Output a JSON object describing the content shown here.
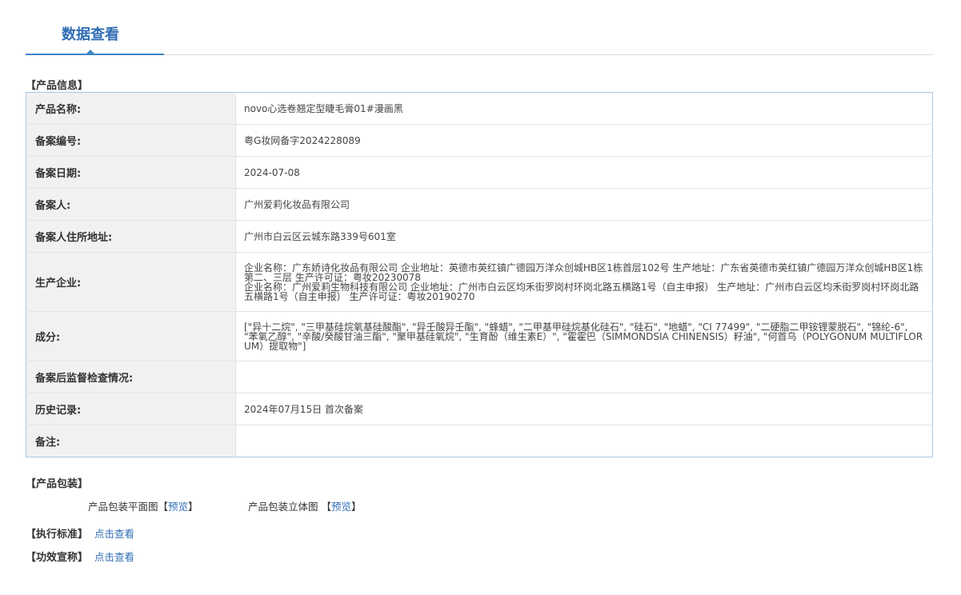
{
  "header": {
    "title": "数据查看"
  },
  "product_info": {
    "heading": "【产品信息】",
    "rows": [
      {
        "label": "产品名称:",
        "value": "novo心选卷翘定型睫毛膏01#漫画黑"
      },
      {
        "label": "备案编号:",
        "value": "粤G妆网备字2024228089"
      },
      {
        "label": "备案日期:",
        "value": "2024-07-08"
      },
      {
        "label": "备案人:",
        "value": "广州爱莉化妆品有限公司"
      },
      {
        "label": "备案人住所地址:",
        "value": "广州市白云区云城东路339号601室"
      },
      {
        "label": "生产企业:",
        "value": "企业名称：广东娇诗化妆品有限公司 企业地址：英德市英红镇广德园万洋众创城HB区1栋首层102号 生产地址：广东省英德市英红镇广德园万洋众创城HB区1栋第二、三层 生产许可证：粤妆20230078\n企业名称：广州爱莉生物科技有限公司 企业地址：广州市白云区均禾街罗岗村环岗北路五横路1号（自主申报） 生产地址：广州市白云区均禾街罗岗村环岗北路五横路1号（自主申报） 生产许可证：粤妆20190270"
      },
      {
        "label": "成分:",
        "value": "[\"异十二烷\", \"三甲基硅烷氧基硅酸酯\", \"异壬酸异壬酯\", \"蜂蜡\", \"二甲基甲硅烷基化硅石\", \"硅石\", \"地蜡\", \"CI 77499\", \"二硬脂二甲铵锂蒙脱石\", \"锦纶-6\", \"苯氧乙醇\", \"辛酸/癸酸甘油三酯\", \"聚甲基硅氧烷\", \"生育酚（维生素E）\", \"霍霍巴（SIMMONDSIA CHINENSIS）籽油\", \"何首乌（POLYGONUM MULTIFLORUM）提取物\"]"
      },
      {
        "label": "备案后监督检查情况:",
        "value": ""
      },
      {
        "label": "历史记录:",
        "value": "2024年07月15日 首次备案"
      },
      {
        "label": "备注:",
        "value": ""
      }
    ]
  },
  "packaging": {
    "heading": "【产品包装】",
    "flat_label": "产品包装平面图",
    "solid_label": "产品包装立体图",
    "bracket_open": "【",
    "bracket_close": "】",
    "preview": "预览"
  },
  "standard": {
    "heading": "【执行标准】",
    "link": "点击查看"
  },
  "efficacy": {
    "heading": "【功效宣称】",
    "link": "点击查看"
  },
  "colors": {
    "accent": "#2f6db5",
    "table_border": "#a9c6e4",
    "label_bg": "#f1f1f1"
  }
}
